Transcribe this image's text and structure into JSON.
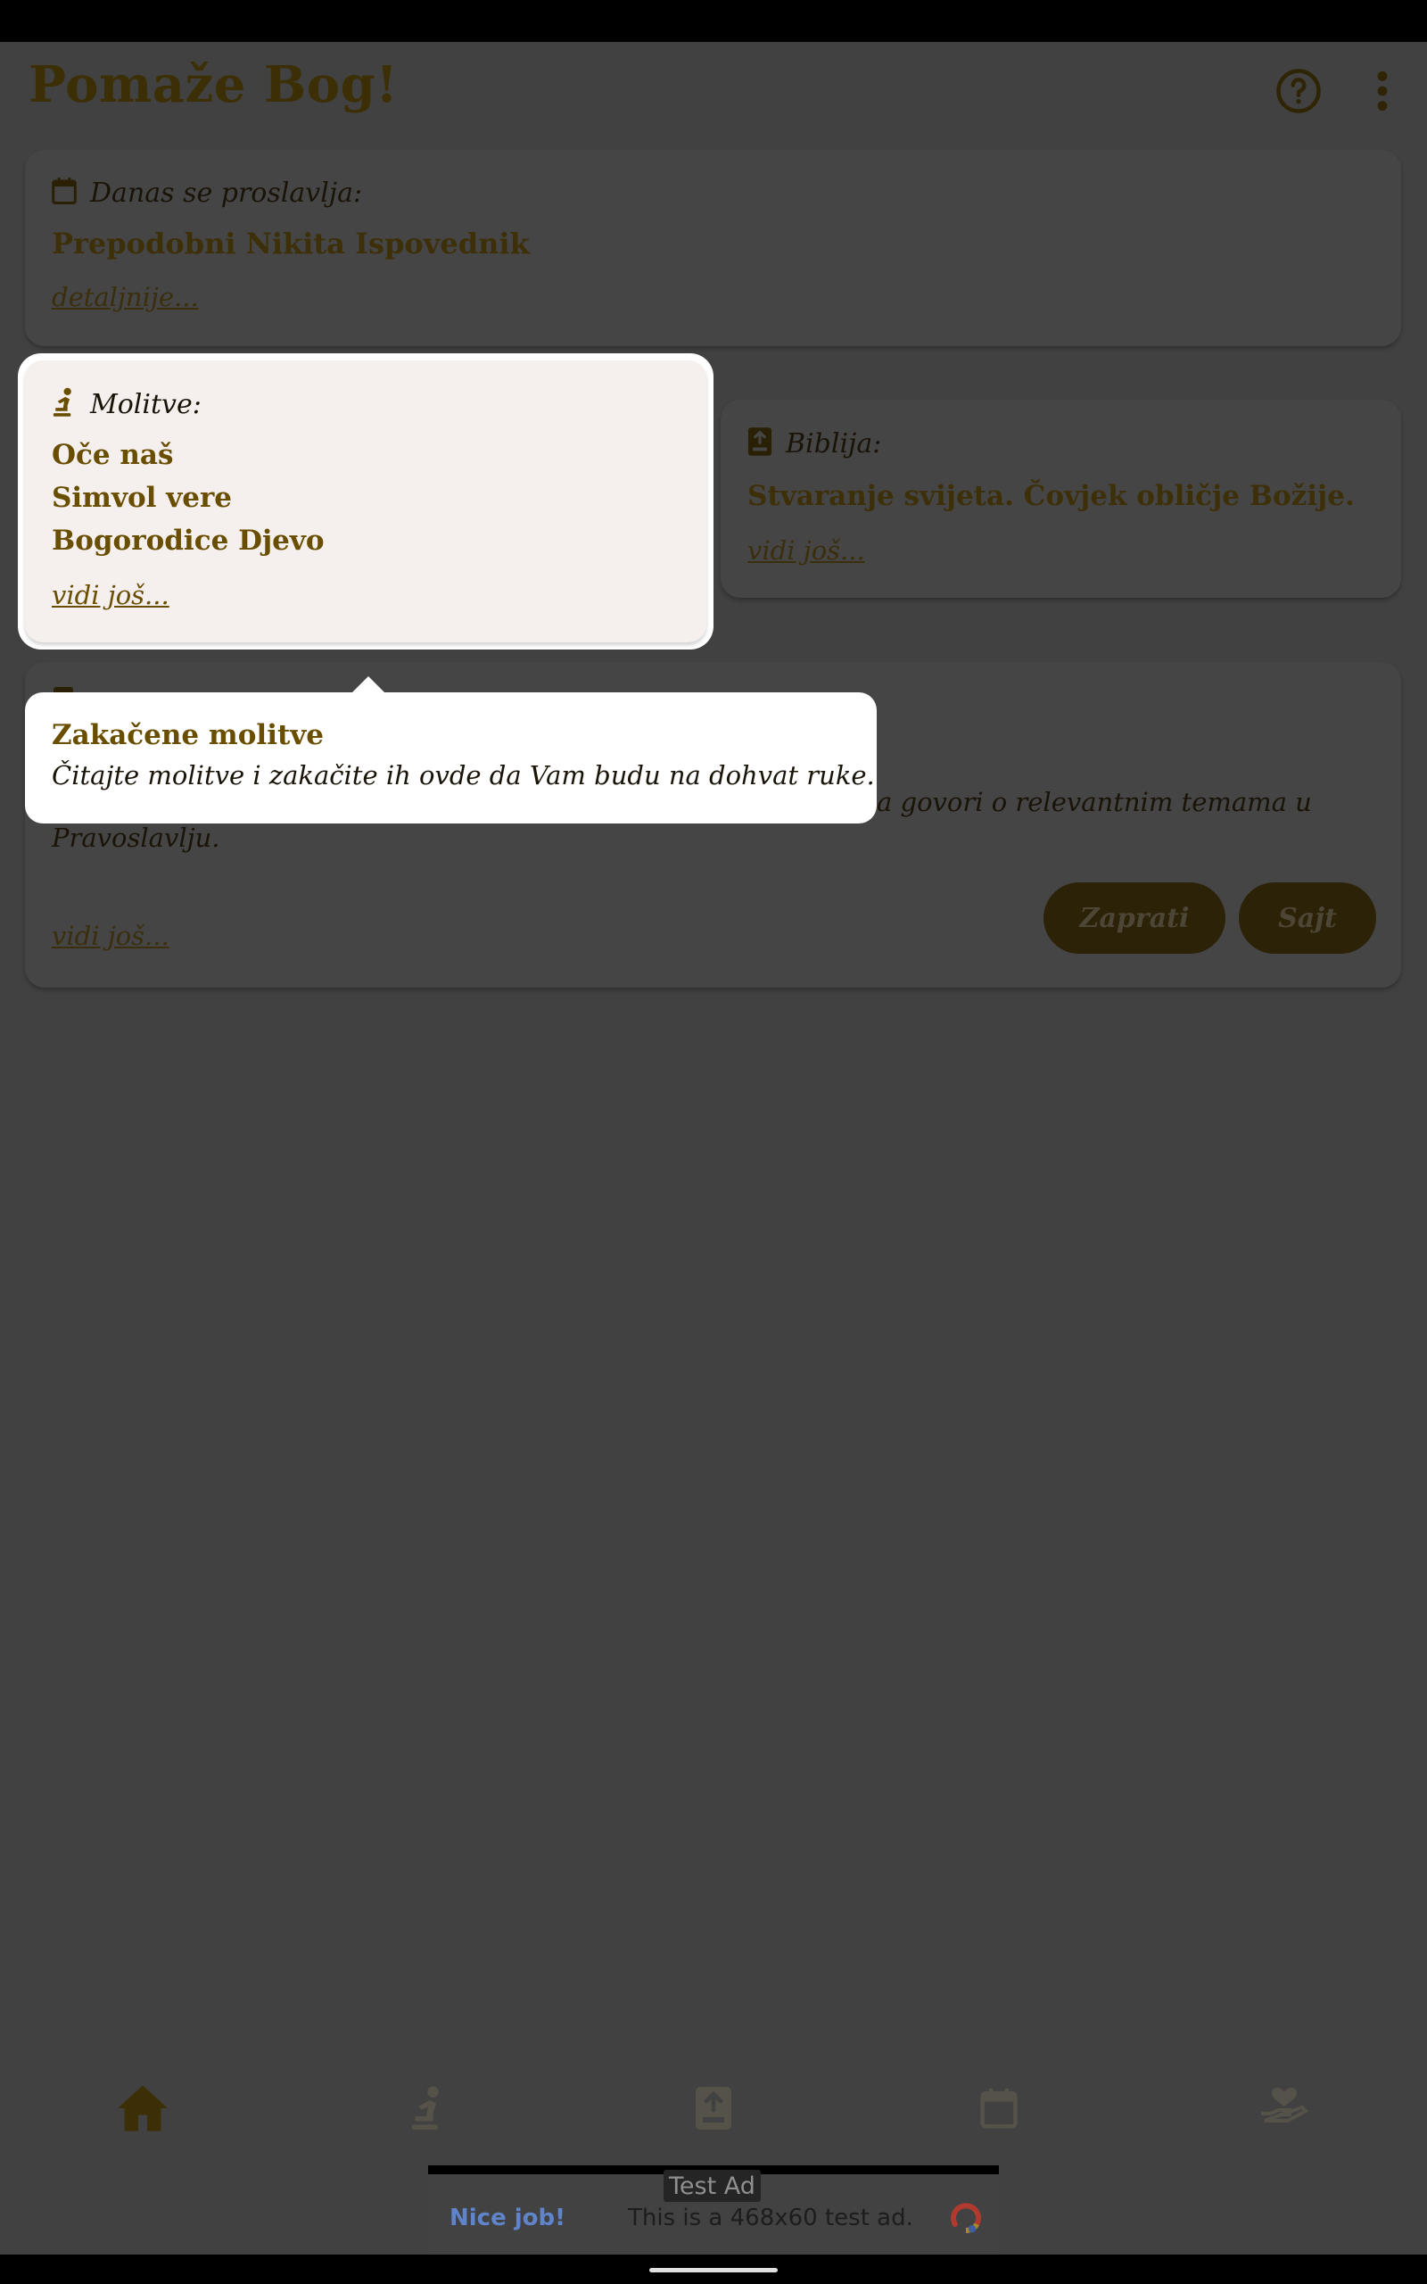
{
  "app": {
    "title": "Pomaže Bog!"
  },
  "toolbar": {
    "help_icon": "help-circle-icon",
    "menu_icon": "more-vert-icon"
  },
  "feast_card": {
    "label": "Danas se proslavlja:",
    "saint": "Prepodobni Nikita Ispovednik",
    "link": "detaljnije..."
  },
  "prayers_card": {
    "label": "Molitve:",
    "items": [
      "Oče naš",
      "Simvol vere",
      "Bogorodice Djevo"
    ],
    "link": "vidi još..."
  },
  "bible_card": {
    "label": "Biblija:",
    "text": "Stvaranje svijeta. Čovjek obličje Božije.",
    "link": "vidi još..."
  },
  "third_card": {
    "body_line1": "a govori o relevantnim temama u",
    "body_line2": "Pravoslavlju.",
    "follow_button": "Zaprati",
    "site_button": "Sajt",
    "link": "vidi još..."
  },
  "tooltip": {
    "title": "Zakačene molitve",
    "text": "Čitajte molitve i zakačite ih ovde da Vam budu na dohvat ruke."
  },
  "bottom_nav": {
    "items": [
      {
        "icon": "home-icon",
        "active": true
      },
      {
        "icon": "pray-icon",
        "active": false
      },
      {
        "icon": "bible-icon",
        "active": false
      },
      {
        "icon": "calendar-icon",
        "active": false
      },
      {
        "icon": "charity-hand-heart-icon",
        "active": false
      }
    ]
  },
  "ad": {
    "label": "Test Ad",
    "nice_job": "Nice job!",
    "text": "This is a 468x60 test ad."
  },
  "colors": {
    "scrim_background": "#414141",
    "brand_dark": "#3c2e05",
    "brand_gold": "#6a4e00",
    "highlight_card": "#f5efee",
    "ad_link_blue": "#5f84c9"
  }
}
